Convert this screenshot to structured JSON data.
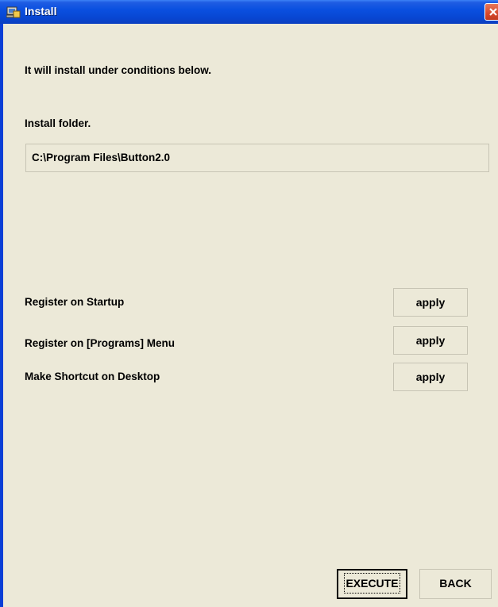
{
  "window": {
    "title": "Install"
  },
  "intro_text": "It will install under conditions below.",
  "install_folder": {
    "label": "Install folder.",
    "path": "C:\\Program Files\\Button2.0"
  },
  "options": [
    {
      "label": "Register on Startup",
      "value": "apply"
    },
    {
      "label": "Register on [Programs] Menu",
      "value": "apply"
    },
    {
      "label": "Make Shortcut on Desktop",
      "value": "apply"
    }
  ],
  "buttons": {
    "execute_label": "EXECUTE",
    "back_label": "BACK"
  },
  "icons": {
    "title": "installer-icon",
    "close": "close-icon"
  },
  "colors": {
    "titlebar": "#0a50e0",
    "close_button": "#d6482c",
    "client_background": "#ece9d8"
  }
}
